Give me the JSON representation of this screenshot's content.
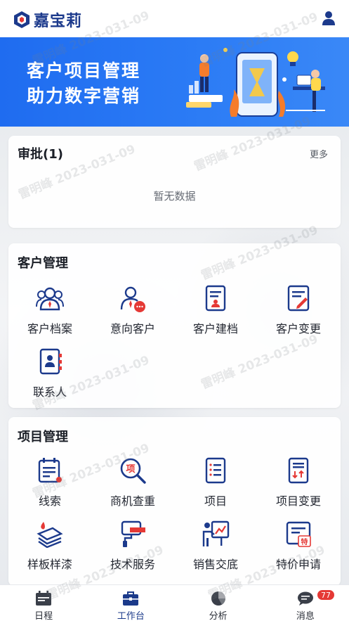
{
  "app": {
    "logo_text": "嘉宝莉",
    "brand_color": "#1c3a8c",
    "accent_color": "#e53935"
  },
  "watermark_text": "雷明峰 2023-031-09",
  "banner": {
    "line1": "客户项目管理",
    "line2": "助力数字营销",
    "bg_color": "#2575f3"
  },
  "approval": {
    "title": "审批(1)",
    "more": "更多",
    "empty": "暂无数据"
  },
  "customer": {
    "title": "客户管理",
    "items": [
      {
        "label": "客户档案",
        "icon": "users-icon"
      },
      {
        "label": "意向客户",
        "icon": "user-chat-icon"
      },
      {
        "label": "客户建档",
        "icon": "profile-doc-icon"
      },
      {
        "label": "客户变更",
        "icon": "edit-doc-icon"
      },
      {
        "label": "联系人",
        "icon": "contact-book-icon"
      }
    ]
  },
  "project": {
    "title": "项目管理",
    "items": [
      {
        "label": "线索",
        "icon": "calendar-list-icon"
      },
      {
        "label": "商机查重",
        "icon": "search-icon"
      },
      {
        "label": "项目",
        "icon": "list-doc-icon"
      },
      {
        "label": "项目变更",
        "icon": "change-list-icon"
      },
      {
        "label": "样板样漆",
        "icon": "paint-layers-icon"
      },
      {
        "label": "技术服务",
        "icon": "paint-roller-icon"
      },
      {
        "label": "销售交底",
        "icon": "presentation-icon"
      },
      {
        "label": "特价申请",
        "icon": "special-price-icon"
      }
    ]
  },
  "tabs": [
    {
      "label": "日程",
      "icon": "calendar-icon",
      "active": false
    },
    {
      "label": "工作台",
      "icon": "briefcase-icon",
      "active": true
    },
    {
      "label": "分析",
      "icon": "pie-chart-icon",
      "active": false
    },
    {
      "label": "消息",
      "icon": "message-icon",
      "active": false,
      "badge": "77"
    }
  ]
}
